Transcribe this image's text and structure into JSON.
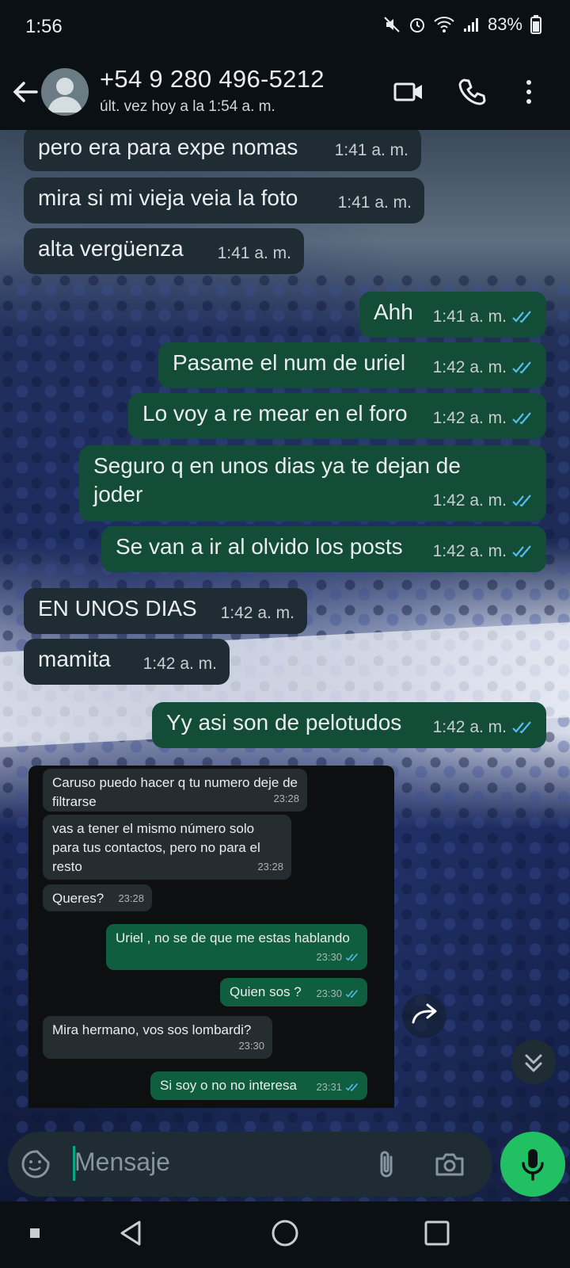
{
  "status_bar": {
    "time": "1:56",
    "battery": "83%"
  },
  "header": {
    "contact": "+54 9 280 496-5212",
    "last_seen": "últ. vez hoy a la 1:54 a. m."
  },
  "messages": [
    {
      "dir": "in",
      "text": "pero era para expe nomas",
      "time": "1:41 a. m."
    },
    {
      "dir": "in",
      "text": "mira si mi vieja veia la foto",
      "time": "1:41 a. m."
    },
    {
      "dir": "in",
      "text": "alta vergüenza",
      "time": "1:41 a. m."
    },
    {
      "dir": "out",
      "text": "Ahh",
      "time": "1:41 a. m."
    },
    {
      "dir": "out",
      "text": "Pasame el num de uriel",
      "time": "1:42 a. m."
    },
    {
      "dir": "out",
      "text": "Lo voy a re mear en el foro",
      "time": "1:42 a. m."
    },
    {
      "dir": "out",
      "text": "Seguro q en unos dias ya te dejan de joder",
      "time": "1:42 a. m."
    },
    {
      "dir": "out",
      "text": "Se van a ir al olvido los posts",
      "time": "1:42 a. m."
    },
    {
      "dir": "in",
      "text": "EN UNOS DIAS",
      "time": "1:42 a. m."
    },
    {
      "dir": "in",
      "text": "mamita",
      "time": "1:42 a. m."
    },
    {
      "dir": "out",
      "text": "Yy asi son de pelotudos",
      "time": "1:42 a. m."
    }
  ],
  "screenshot_messages": [
    {
      "dir": "in",
      "text": "Caruso puedo hacer q tu numero deje de filtrarse",
      "time": "23:28"
    },
    {
      "dir": "in",
      "text": "vas a tener el mismo número solo para tus contactos,  pero no para el resto",
      "time": "23:28"
    },
    {
      "dir": "in",
      "text": "Queres?",
      "time": "23:28"
    },
    {
      "dir": "out",
      "text": "Uriel , no se de que me estas hablando",
      "time": "23:30"
    },
    {
      "dir": "out",
      "text": "Quien sos ?",
      "time": "23:30"
    },
    {
      "dir": "in",
      "text": "Mira hermano, vos sos lombardi?",
      "time": "23:30"
    },
    {
      "dir": "out",
      "text": "Si soy o no no interesa",
      "time": "23:31"
    }
  ],
  "composer": {
    "placeholder": "Mensaje"
  },
  "icons": [
    "back-arrow-icon",
    "avatar-icon",
    "video-call-icon",
    "phone-icon",
    "more-vert-icon",
    "sticker-icon",
    "attach-icon",
    "camera-icon",
    "mic-icon",
    "forward-icon",
    "scroll-down-icon",
    "read-ticks-icon"
  ],
  "colors": {
    "incoming": "#1f2c34",
    "outgoing": "#134d37",
    "accent": "#21c063",
    "ticks": "#53bdeb"
  }
}
